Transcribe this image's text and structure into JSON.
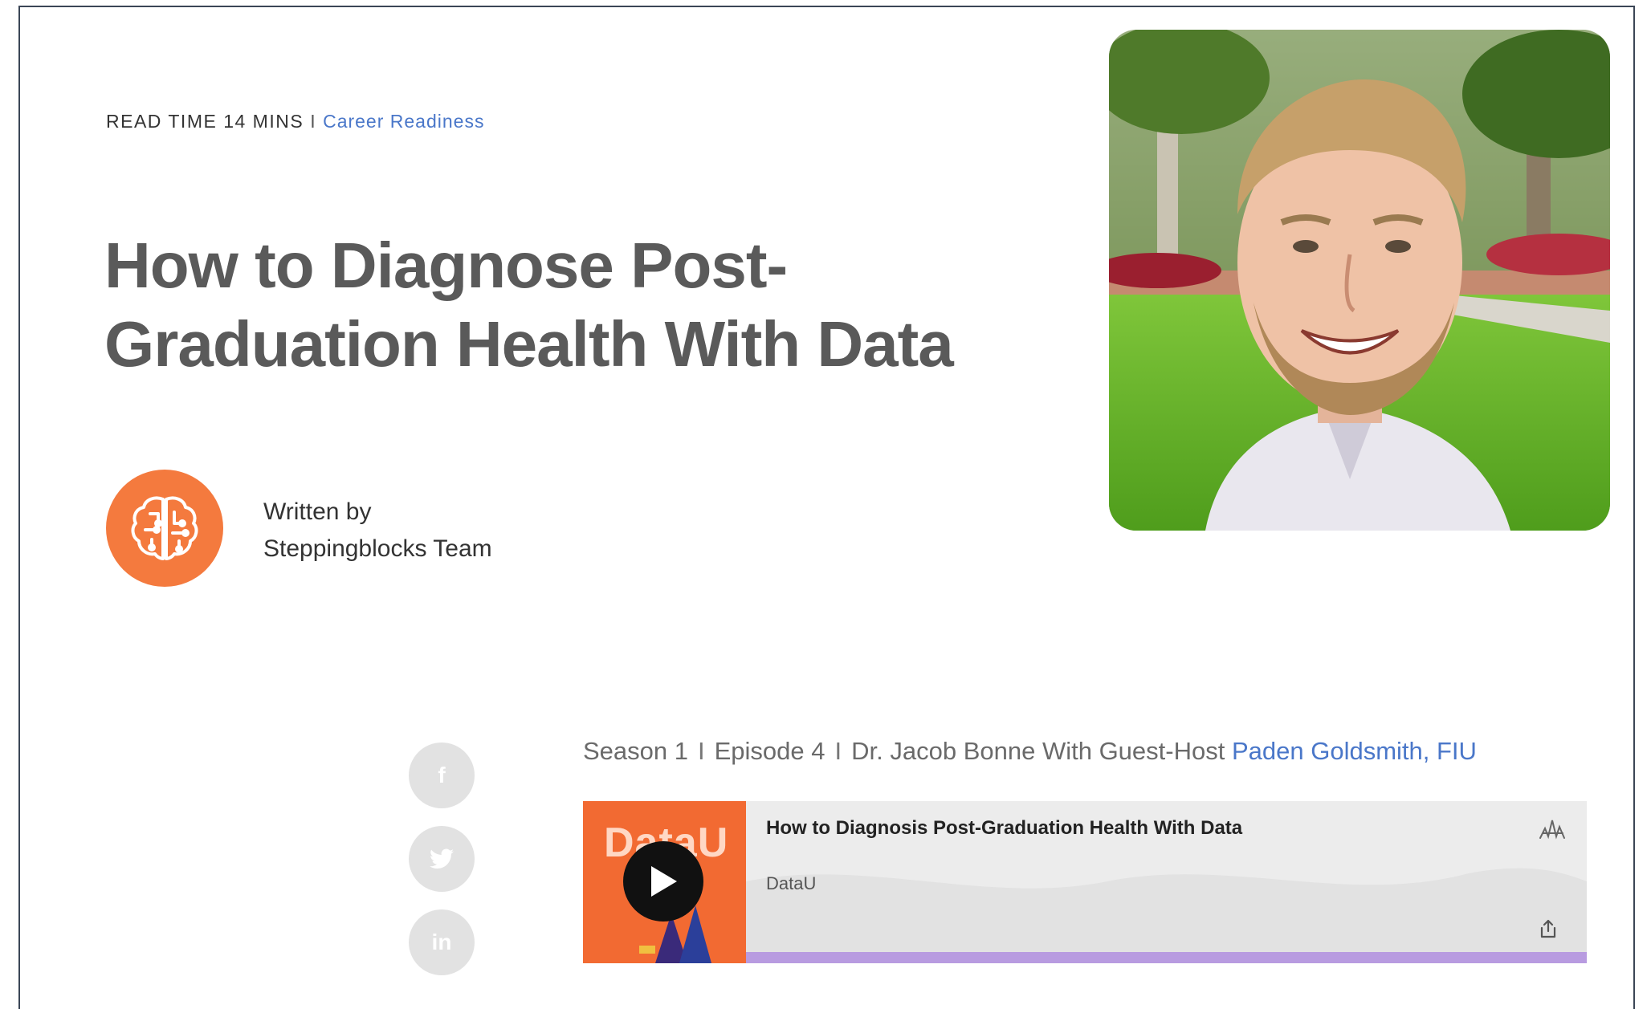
{
  "article": {
    "read_time": "READ TIME 14 MINS",
    "separator": "I",
    "category": "Career Readiness",
    "title": "How to Diagnose Post-Graduation Health With Data",
    "author_label": "Written by",
    "author_name": "Steppingblocks Team"
  },
  "social": [
    {
      "name": "facebook",
      "glyph": "f"
    },
    {
      "name": "twitter",
      "glyph": "t"
    },
    {
      "name": "linkedin",
      "glyph": "in"
    }
  ],
  "episode": {
    "season": "Season 1",
    "episode": "Episode 4",
    "host_text": "Dr. Jacob Bonne With Guest-Host",
    "guest_link": "Paden Goldsmith, FIU",
    "divider": "I"
  },
  "player": {
    "episode_title": "How to Diagnosis Post-Graduation Health With Data",
    "show_name": "DataU",
    "cover_brand": "DataU",
    "progress": 1.0,
    "icons": {
      "play": "play-icon",
      "logo": "anchor-logo-icon",
      "share": "share-icon"
    }
  },
  "colors": {
    "accent_blue": "#4a77c9",
    "avatar_orange": "#f47a3e",
    "title_gray": "#5a5a5a",
    "progress_purple": "#b89be0"
  }
}
